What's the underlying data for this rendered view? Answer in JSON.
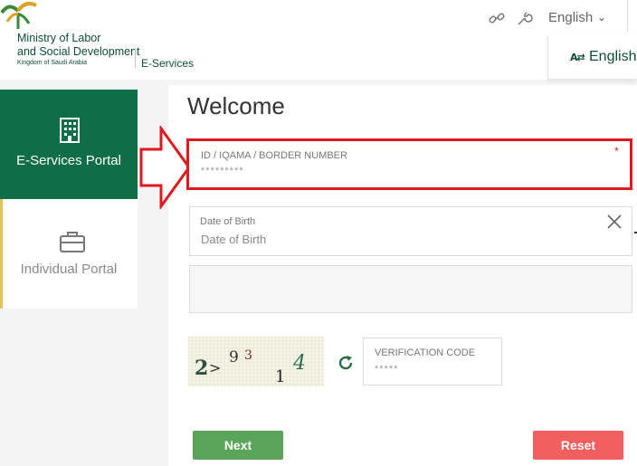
{
  "header": {
    "org_line1": "Ministry of Labor",
    "org_line2": "and Social Development",
    "org_line3": "Kingdom of Saudi Arabia",
    "section_title": "E-Services",
    "language_current": "English",
    "language_dropdown_item": "English",
    "language_dropdown_icon_text": "A⇄"
  },
  "sidebar": {
    "items": [
      {
        "label": "E-Services Portal",
        "icon": "building-icon",
        "active": true
      },
      {
        "label": "Individual Portal",
        "icon": "briefcase-icon",
        "active": false
      }
    ]
  },
  "form": {
    "title": "Welcome",
    "id_field": {
      "label": "ID / IQAMA / BORDER NUMBER",
      "placeholder": "*********",
      "required_mark": "*"
    },
    "dob_field": {
      "label": "Date of Birth",
      "placeholder": "Date of Birth"
    },
    "captcha_text": "29314",
    "verification_field": {
      "label": "VERIFICATION CODE",
      "placeholder": "*****"
    },
    "next_label": "Next",
    "reset_label": "Reset"
  },
  "colors": {
    "brand_green": "#0f6e48",
    "highlight_red": "#e0191f",
    "next_green": "#5aa55a",
    "reset_red": "#f25f5f",
    "individual_accent": "#e6c15a"
  }
}
